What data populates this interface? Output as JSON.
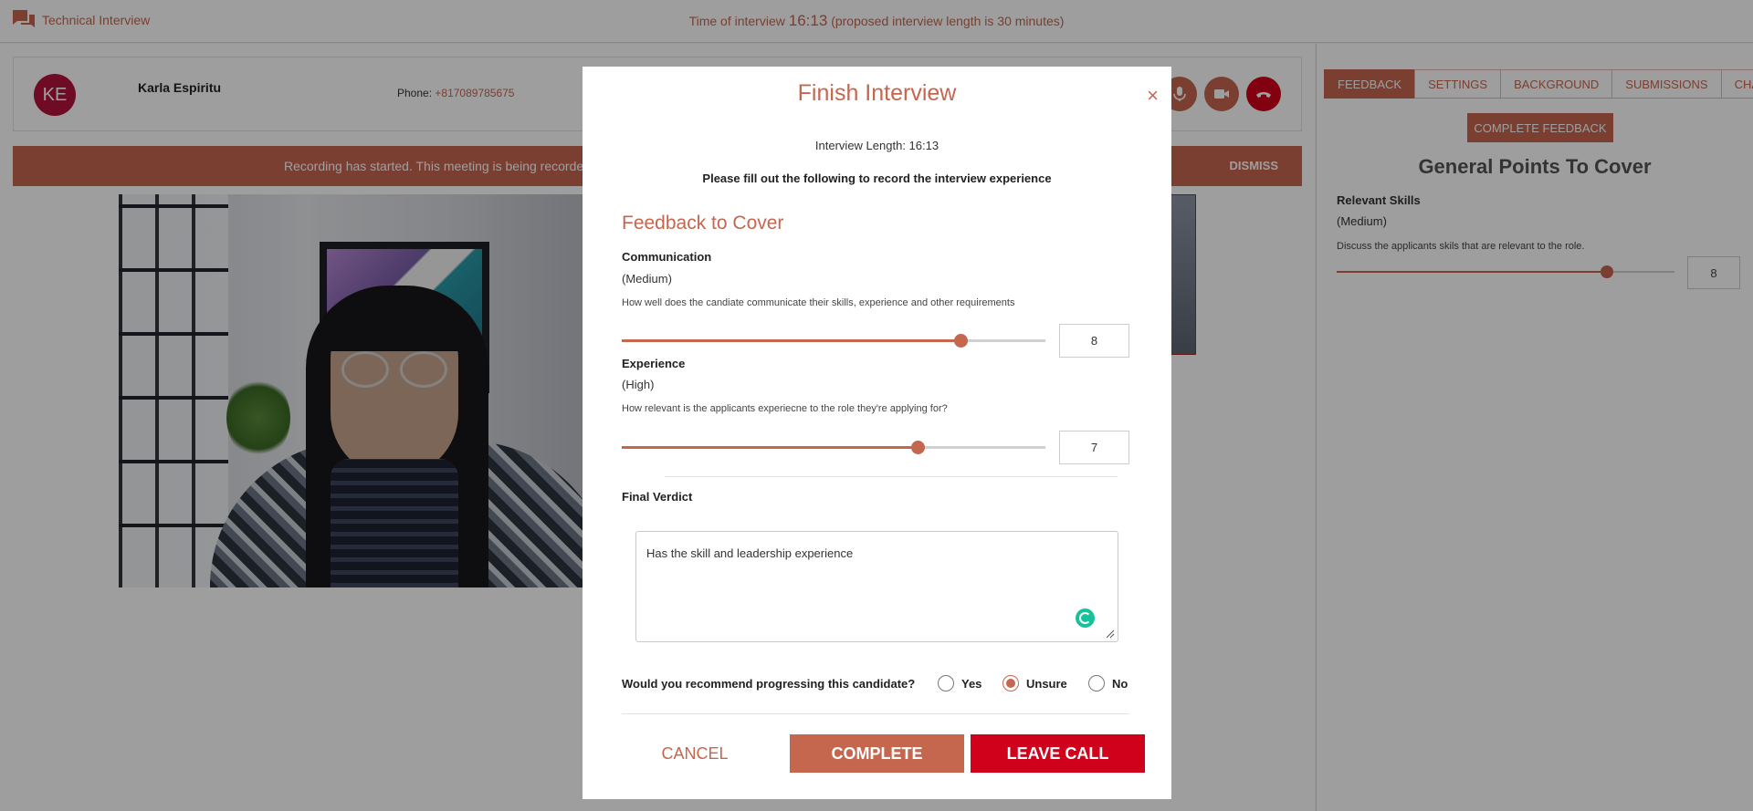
{
  "app": {
    "title": "Technical Interview",
    "timer_prefix": "Time of interview",
    "timer_value": "16:13",
    "timer_suffix": "(proposed interview length is 30 minutes)"
  },
  "candidate": {
    "initials": "KE",
    "name": "Karla Espiritu",
    "phone_label": "Phone:",
    "phone": "+817089785675"
  },
  "banner": {
    "text": "Recording has started. This meeting is being recorded",
    "dismiss": "DISMISS"
  },
  "side": {
    "tabs": [
      "FEEDBACK",
      "SETTINGS",
      "BACKGROUND",
      "SUBMISSIONS",
      "CHAT"
    ],
    "complete_feedback": "COMPLETE FEEDBACK",
    "title": "General Points To Cover",
    "skill": {
      "title": "Relevant Skills",
      "level": "(Medium)",
      "description": "Discuss the applicants skils that are relevant to the role.",
      "value": "8",
      "fraction": 0.8
    }
  },
  "modal": {
    "title": "Finish Interview",
    "close": "×",
    "length": "Interview Length: 16:13",
    "instruction": "Please fill out the following to record the interview experience",
    "section": "Feedback to Cover",
    "criteria": [
      {
        "title": "Communication",
        "level": "(Medium)",
        "description": "How well does the candiate communicate their skills, experience and other requirements",
        "value": "8",
        "fraction": 0.8
      },
      {
        "title": "Experience",
        "level": "(High)",
        "description": "How relevant is the applicants experiecne to the role they're applying for?",
        "value": "7",
        "fraction": 0.7
      }
    ],
    "verdict_label": "Final Verdict",
    "verdict_text": "Has the skill and leadership experience",
    "recommend_question": "Would you recommend progressing this candidate?",
    "options": [
      {
        "label": "Yes",
        "checked": false
      },
      {
        "label": "Unsure",
        "checked": true
      },
      {
        "label": "No",
        "checked": false
      }
    ],
    "buttons": {
      "cancel": "CANCEL",
      "complete": "COMPLETE",
      "leave": "LEAVE CALL"
    }
  },
  "colors": {
    "accent": "#c5664f",
    "danger": "#d0021b",
    "avatar": "#b3123d"
  },
  "icons": [
    "chat-bubbles-icon",
    "microphone-icon",
    "video-camera-icon",
    "hang-up-icon",
    "close-icon",
    "grammarly-icon",
    "resize-grip-icon"
  ]
}
